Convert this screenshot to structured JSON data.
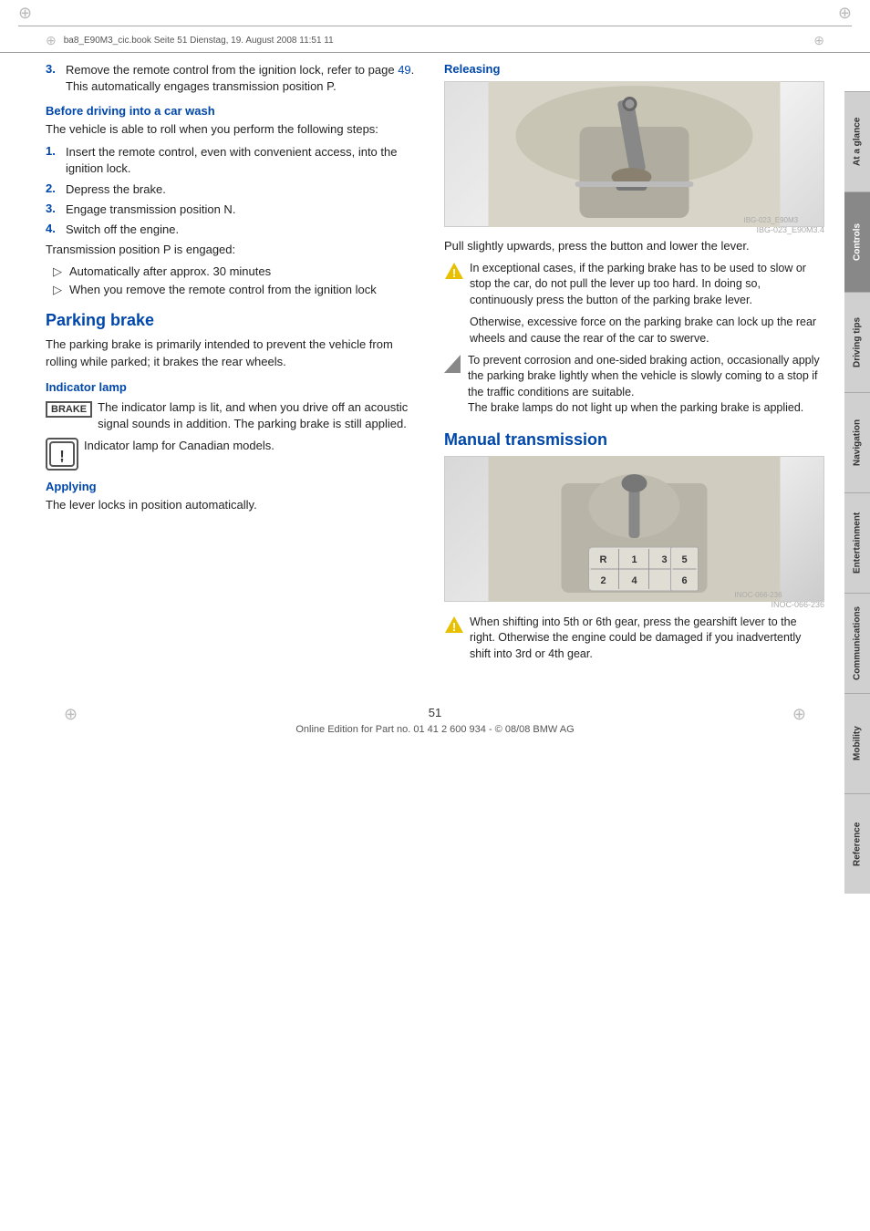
{
  "header": {
    "filepath": "ba8_E90M3_cic.book  Seite 51  Dienstag, 19. August 2008  11:51 11"
  },
  "left_col": {
    "step3": {
      "num": "3.",
      "text": "Remove the remote control from the ignition lock, refer to page ",
      "link": "49",
      "text2": ". This automatically engages transmission position P."
    },
    "before_carwash": {
      "heading": "Before driving into a car wash",
      "intro": "The vehicle is able to roll when you perform the following steps:",
      "steps": [
        {
          "num": "1.",
          "text": "Insert the remote control, even with convenient access, into the ignition lock."
        },
        {
          "num": "2.",
          "text": "Depress the brake."
        },
        {
          "num": "3.",
          "text": "Engage transmission position N."
        },
        {
          "num": "4.",
          "text": "Switch off the engine."
        }
      ],
      "transmission_text": "Transmission position P is engaged:",
      "bullets": [
        "Automatically after approx. 30 minutes",
        "When you remove the remote control from the ignition lock"
      ]
    },
    "parking_brake": {
      "heading": "Parking brake",
      "intro": "The parking brake is primarily intended to prevent the vehicle from rolling while parked; it brakes the rear wheels.",
      "indicator_heading": "Indicator lamp",
      "brake_label": "BRAKE",
      "brake_text": "The indicator lamp is lit, and when you drive off an acoustic signal sounds in addition. The parking brake is still applied.",
      "canadian_text": "Indicator lamp for Canadian models.",
      "canadian_icon": "⓵",
      "applying_heading": "Applying",
      "applying_text": "The lever locks in position automatically."
    }
  },
  "right_col": {
    "releasing": {
      "heading": "Releasing",
      "image_caption": "IBG-023_E90M3.4",
      "description": "Pull slightly upwards, press the button and lower the lever.",
      "warning1": "In exceptional cases, if the parking brake has to be used to slow or stop the car, do not pull the lever up too hard. In doing so, continuously press the button of the parking brake lever.",
      "warning2_text": "Otherwise, excessive force on the parking brake can lock up the rear wheels and cause the rear of the car to swerve.",
      "note1": "To prevent corrosion and one-sided braking action, occasionally apply the parking brake lightly when the vehicle is slowly coming to a stop if the traffic conditions are suitable.",
      "note2": "The brake lamps do not light up when the parking brake is applied."
    },
    "manual_transmission": {
      "heading": "Manual transmission",
      "image_caption": "INOC-066-236",
      "gear_labels": {
        "R": "R",
        "1": "1",
        "2": "2",
        "3": "3",
        "4": "4",
        "5": "5",
        "6": "6"
      },
      "warning": "When shifting into 5th or 6th gear, press the gearshift lever to the right. Otherwise the engine could be damaged if you inadvertently shift into 3rd or 4th gear."
    }
  },
  "footer": {
    "page_num": "51",
    "text": "Online Edition for Part no. 01 41 2 600 934 - © 08/08 BMW AG"
  },
  "sidebar_tabs": [
    {
      "label": "At a glance",
      "active": false
    },
    {
      "label": "Controls",
      "active": true
    },
    {
      "label": "Driving tips",
      "active": false
    },
    {
      "label": "Navigation",
      "active": false
    },
    {
      "label": "Entertainment",
      "active": false
    },
    {
      "label": "Communications",
      "active": false
    },
    {
      "label": "Mobility",
      "active": false
    },
    {
      "label": "Reference",
      "active": false
    }
  ]
}
